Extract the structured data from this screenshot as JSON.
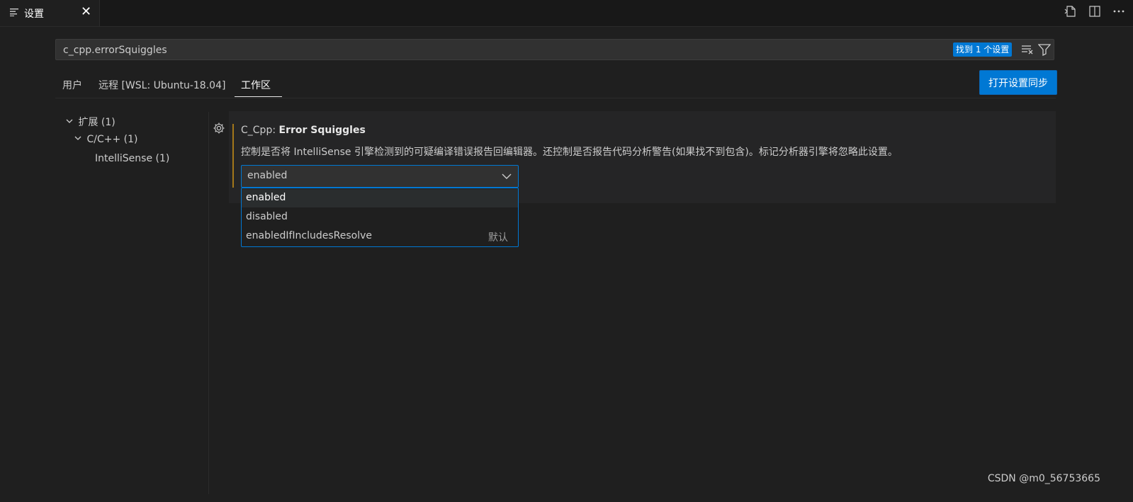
{
  "tab": {
    "title": "设置",
    "close": "✕"
  },
  "search": {
    "value": "c_cpp.errorSquiggles",
    "result_count": "找到 1 个设置"
  },
  "scopes": [
    {
      "label": "用户"
    },
    {
      "label": "远程 [WSL: Ubuntu-18.04]"
    },
    {
      "label": "工作区"
    }
  ],
  "sync_button": "打开设置同步",
  "toc": [
    {
      "label": "扩展 (1)"
    },
    {
      "label": "C/C++ (1)"
    },
    {
      "label": "IntelliSense (1)"
    }
  ],
  "setting": {
    "category": "C_Cpp: ",
    "name": "Error Squiggles",
    "description": "控制是否将 IntelliSense 引擎检测到的可疑编译错误报告回编辑器。还控制是否报告代码分析警告(如果找不到包含)。标记分析器引擎将忽略此设置。",
    "value": "enabled",
    "options": [
      {
        "label": "enabled",
        "tag": ""
      },
      {
        "label": "disabled",
        "tag": ""
      },
      {
        "label": "enabledIfIncludesResolve",
        "tag": "默认"
      }
    ]
  },
  "watermark": "CSDN @m0_56753665",
  "colors": {
    "accent": "#0078d4",
    "modified_bar": "#a3771a",
    "background": "#1f1f1f"
  }
}
